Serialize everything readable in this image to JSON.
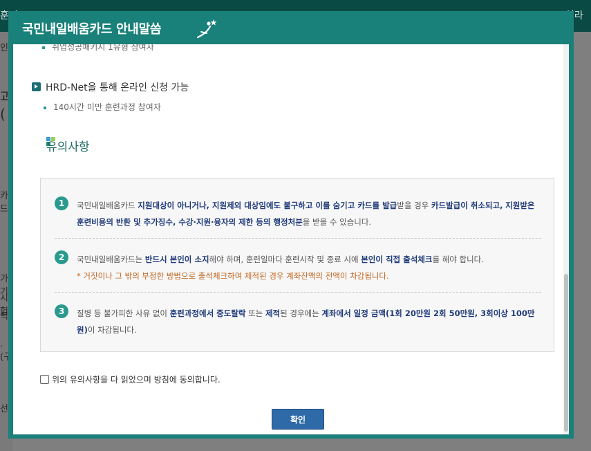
{
  "background": {
    "top_tabs": [
      "훈련",
      "일라취"
    ],
    "left_fragments": [
      "인)",
      "과(",
      "카드",
      "가기",
      "시험",
      "력.",
      ".(구",
      "선"
    ]
  },
  "modal": {
    "title": "국민내일배움카드 안내말씀",
    "ghost_line": "취업성공패키지 1유형 참여자",
    "method": {
      "title": "HRD-Net을 통해 온라인 신청 가능",
      "sub": "140시간 미만 훈련과정 참여자"
    },
    "section_title": "유의사항",
    "notices": [
      {
        "num": "1",
        "parts": [
          {
            "t": "국민내일배움카드 "
          },
          {
            "t": "지원대상이 아니거나, 지원제외 대상임에도 불구하고 이를 숨기고 카드를 발급",
            "b": true
          },
          {
            "t": "받을 경우 "
          },
          {
            "t": "카드발급이 취소되고,",
            "b": true
          },
          {
            "t": " "
          },
          {
            "t": "지원받은 훈련비용의 반환 및 추가징수, 수강·지원·융자의 제한 등의 행정처분",
            "b": true
          },
          {
            "t": "을 받을 수 있습니다."
          }
        ]
      },
      {
        "num": "2",
        "parts": [
          {
            "t": "국민내일배움카드는 "
          },
          {
            "t": "반드시 본인이 소지",
            "b": true
          },
          {
            "t": "해야 하며, 훈련일마다 훈련시작 및 종료 시에 "
          },
          {
            "t": "본인이 직접 출석체크",
            "b": true
          },
          {
            "t": "를 해야 합니다."
          }
        ],
        "warning": "* 거짓이나 그 밖의 부정한 방법으로 출석체크하여 제적된 경우 계좌잔액의 전액이 차감됩니다."
      },
      {
        "num": "3",
        "parts": [
          {
            "t": "질병 등 불가피한 사유 없이 "
          },
          {
            "t": "훈련과정에서 중도탈락",
            "b": true
          },
          {
            "t": " 또는 "
          },
          {
            "t": "제적",
            "b": true
          },
          {
            "t": "된 경우에는 "
          },
          {
            "t": "계좌에서 일정 금액(1회 20만원 2회 50만원, 3회이상 100만원)",
            "b": true
          },
          {
            "t": "이 차감됩니다."
          }
        ]
      }
    ],
    "agree_label": "위의 유의사항을 다 읽었으며 방침에 동의합니다.",
    "confirm_label": "확인"
  },
  "colors": {
    "header": "#19807a",
    "accent_teal": "#2a9a8f",
    "emphasis_navy": "#1f3a7a",
    "warning_orange": "#c0651f",
    "button_blue": "#2e6aa8"
  }
}
